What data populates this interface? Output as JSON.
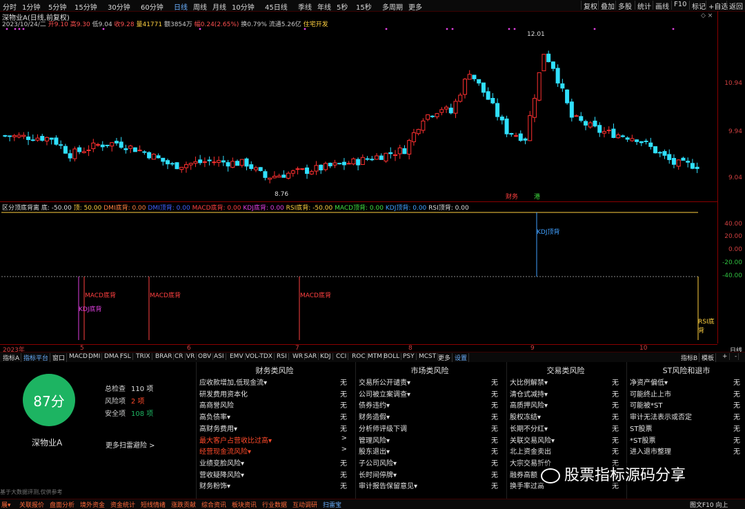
{
  "timeframes": [
    {
      "label": "分时",
      "active": false
    },
    {
      "label": "1分钟",
      "active": false
    },
    {
      "label": "5分钟",
      "active": false
    },
    {
      "label": "15分钟",
      "active": false
    },
    {
      "label": "30分钟",
      "active": false
    },
    {
      "label": "60分钟",
      "active": false
    },
    {
      "label": "日线",
      "active": true
    },
    {
      "label": "周线",
      "active": false
    },
    {
      "label": "月线",
      "active": false
    },
    {
      "label": "10分钟",
      "active": false
    },
    {
      "label": "45日线",
      "active": false
    },
    {
      "label": "季线",
      "active": false
    },
    {
      "label": "年线",
      "active": false
    },
    {
      "label": "5秒",
      "active": false
    },
    {
      "label": "15秒",
      "active": false
    },
    {
      "label": "多周期",
      "active": false
    },
    {
      "label": "更多",
      "active": false
    }
  ],
  "right_buttons": [
    "复权",
    "叠加",
    "多股",
    "统计",
    "画线",
    "F10",
    "标记",
    "+自选",
    "返回"
  ],
  "stock": {
    "title": "深物业A(日线,前复权)",
    "date": "2023/10/24/二",
    "open": "开9.10",
    "high": "高9.30",
    "low": "低9.04",
    "close": "收9.28",
    "volume": "量41771",
    "amount": "额3854万",
    "change": "幅0.24(2.65%)",
    "turnover": "换0.79%",
    "float_cap": "流通5.26亿",
    "sector": "住宅开发"
  },
  "price_axis": [
    "10.94",
    "9.94",
    "9.04"
  ],
  "annotations": {
    "high": "12.01",
    "low": "8.76",
    "tag1": "财务",
    "tag2": "港"
  },
  "indicator": {
    "name": "区分顶底背离",
    "legend": [
      "底: -50.00",
      "顶: 50.00",
      "DMI底背: 0.00",
      "DMI顶背: 0.00",
      "MACD底背: 0.00",
      "KDJ底背: 0.00",
      "RSI底背: -50.00",
      "MACD顶背: 0.00",
      "KDJ顶背: 0.00",
      "RSI顶背: 0.00"
    ],
    "axis": [
      "40.00",
      "20.00",
      "0.00",
      "-20.00",
      "-40.00"
    ],
    "labels": [
      "MACD底背",
      "KDJ底背",
      "MACD底背",
      "MACD底背",
      "KDJ顶背",
      "RSI底背"
    ]
  },
  "date_axis": [
    "2023年",
    "5",
    "6",
    "7",
    "8",
    "9",
    "10"
  ],
  "date_axis_right": "日线",
  "indicator_tabs": [
    "指标A",
    "指标平台",
    "窗口",
    "MACD",
    "DMI",
    "DMA",
    "FSL",
    "TRIX",
    "BRAR",
    "CR",
    "VR",
    "OBV",
    "ASI",
    "EMV",
    "VOL-TDX",
    "RSI",
    "WR",
    "SAR",
    "KDJ",
    "CCI",
    "ROC",
    "MTM",
    "BOLL",
    "PSY",
    "MCST",
    "更多",
    "设置"
  ],
  "indicator_tabs_right": [
    "指标B",
    "模板",
    "+",
    "-"
  ],
  "risk": {
    "score": "87分",
    "stock_name": "深物业A",
    "total_label": "总检查",
    "total_value": "110 项",
    "risk_label": "风险项",
    "risk_value": "2 项",
    "safe_label": "安全项",
    "safe_value": "108 项",
    "more": "更多扫雷避险 >",
    "footnote": "基于大数据评测,仅供参考",
    "columns": [
      {
        "title": "财务类风险",
        "items": [
          {
            "name": "应收款增加,低现金流▾",
            "status": "无"
          },
          {
            "name": "研发费用资本化",
            "status": "无"
          },
          {
            "name": "高商誉风险",
            "status": "无"
          },
          {
            "name": "高负债率▾",
            "status": "无"
          },
          {
            "name": "高财务费用▾",
            "status": "无"
          },
          {
            "name": "最大客户占营收比过高▾",
            "status": ">"
          },
          {
            "name": "经营现金流风险▾",
            "status": ">"
          },
          {
            "name": "业绩变脸风险▾",
            "status": "无"
          },
          {
            "name": "营收疑降风险▾",
            "status": "无"
          },
          {
            "name": "财务粉饰▾",
            "status": "无"
          }
        ]
      },
      {
        "title": "市场类风险",
        "items": [
          {
            "name": "交易所公开谴责▾",
            "status": "无"
          },
          {
            "name": "公司被立案调查▾",
            "status": "无"
          },
          {
            "name": "债券违约▾",
            "status": "无"
          },
          {
            "name": "财务造假▾",
            "status": "无"
          },
          {
            "name": "分析师评级下调",
            "status": "无"
          },
          {
            "name": "管理风险▾",
            "status": "无"
          },
          {
            "name": "股东退出▾",
            "status": "无"
          },
          {
            "name": "子公司风险▾",
            "status": "无"
          },
          {
            "name": "长时间停牌▾",
            "status": "无"
          },
          {
            "name": "审计报告保留意见▾",
            "status": "无"
          }
        ]
      },
      {
        "title": "交易类风险",
        "items": [
          {
            "name": "大比例解禁▾",
            "status": "无"
          },
          {
            "name": "清仓式减持▾",
            "status": "无"
          },
          {
            "name": "高质押风险▾",
            "status": "无"
          },
          {
            "name": "股权冻结▾",
            "status": "无"
          },
          {
            "name": "长期不分红▾",
            "status": "无"
          },
          {
            "name": "关联交易风险▾",
            "status": "无"
          },
          {
            "name": "北上资金卖出",
            "status": "无"
          },
          {
            "name": "大宗交易折价",
            "status": "无"
          },
          {
            "name": "融券高额",
            "status": "无"
          },
          {
            "name": "换手率过高",
            "status": "无"
          }
        ]
      },
      {
        "title": "ST风险和退市",
        "items": [
          {
            "name": "净资产偏低▾",
            "status": "无"
          },
          {
            "name": "可能终止上市",
            "status": "无"
          },
          {
            "name": "可能被*ST",
            "status": "无"
          },
          {
            "name": "审计无法表示或否定",
            "status": "无"
          },
          {
            "name": "ST股票",
            "status": "无"
          },
          {
            "name": "*ST股票",
            "status": "无"
          },
          {
            "name": "进入退市整理",
            "status": "无"
          }
        ]
      }
    ]
  },
  "watermark": "股票指标源码分享",
  "status_bar": [
    "展▾",
    "关联报价",
    "盘面分析",
    "境外资金",
    "资金统计",
    "短线情绪",
    "涨跌贡献",
    "综合资讯",
    "板块资讯",
    "行业数据",
    "互动调研",
    "扫雷宝"
  ],
  "status_right": "图文F10 向上",
  "colors": {
    "up": "#ff3030",
    "down": "#30e0ff",
    "score": "#1db462",
    "risk": "#ff4a2a"
  }
}
